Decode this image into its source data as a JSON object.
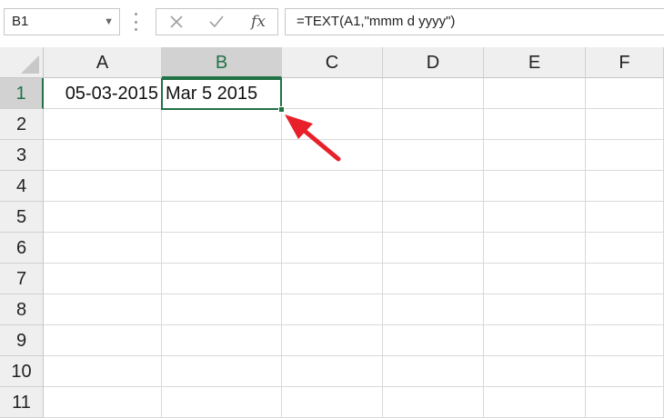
{
  "name_box": {
    "value": "B1",
    "dropdown_icon": "chevron-down-icon"
  },
  "formula_bar": {
    "cancel_icon": "x-icon",
    "enter_icon": "check-icon",
    "function_label": "fx",
    "formula": "=TEXT(A1,\"mmm d yyyy\")"
  },
  "columns": [
    "A",
    "B",
    "C",
    "D",
    "E",
    "F"
  ],
  "rows": [
    "1",
    "2",
    "3",
    "4",
    "5",
    "6",
    "7",
    "8",
    "9",
    "10",
    "11"
  ],
  "selected_cell": "B1",
  "cells": {
    "A1": "05-03-2015",
    "B1": "Mar 5 2015"
  },
  "colors": {
    "selection": "#217346",
    "arrow": "#e8202a"
  }
}
